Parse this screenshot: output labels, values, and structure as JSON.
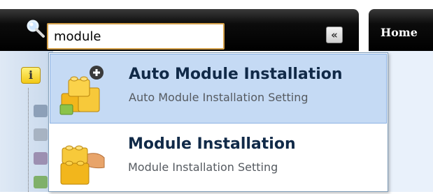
{
  "header": {
    "home_tab_label": "Home",
    "collapse_glyph": "«"
  },
  "search": {
    "value": "module",
    "icon": "search-icon"
  },
  "sidebar": {
    "info_glyph": "i"
  },
  "dropdown": {
    "items": [
      {
        "title": "Auto Module Installation",
        "subtitle": "Auto Module Installation Setting",
        "icon": "puzzle-box-add-icon",
        "selected": true
      },
      {
        "title": "Module Installation",
        "subtitle": "Module Installation Setting",
        "icon": "puzzle-box-hand-icon",
        "selected": false
      }
    ]
  },
  "colors": {
    "header_bg": "#000000",
    "selection_bg": "#c5daf4",
    "selection_border": "#8db2e3",
    "input_border": "#d4a04a",
    "title_text": "#112a48"
  }
}
